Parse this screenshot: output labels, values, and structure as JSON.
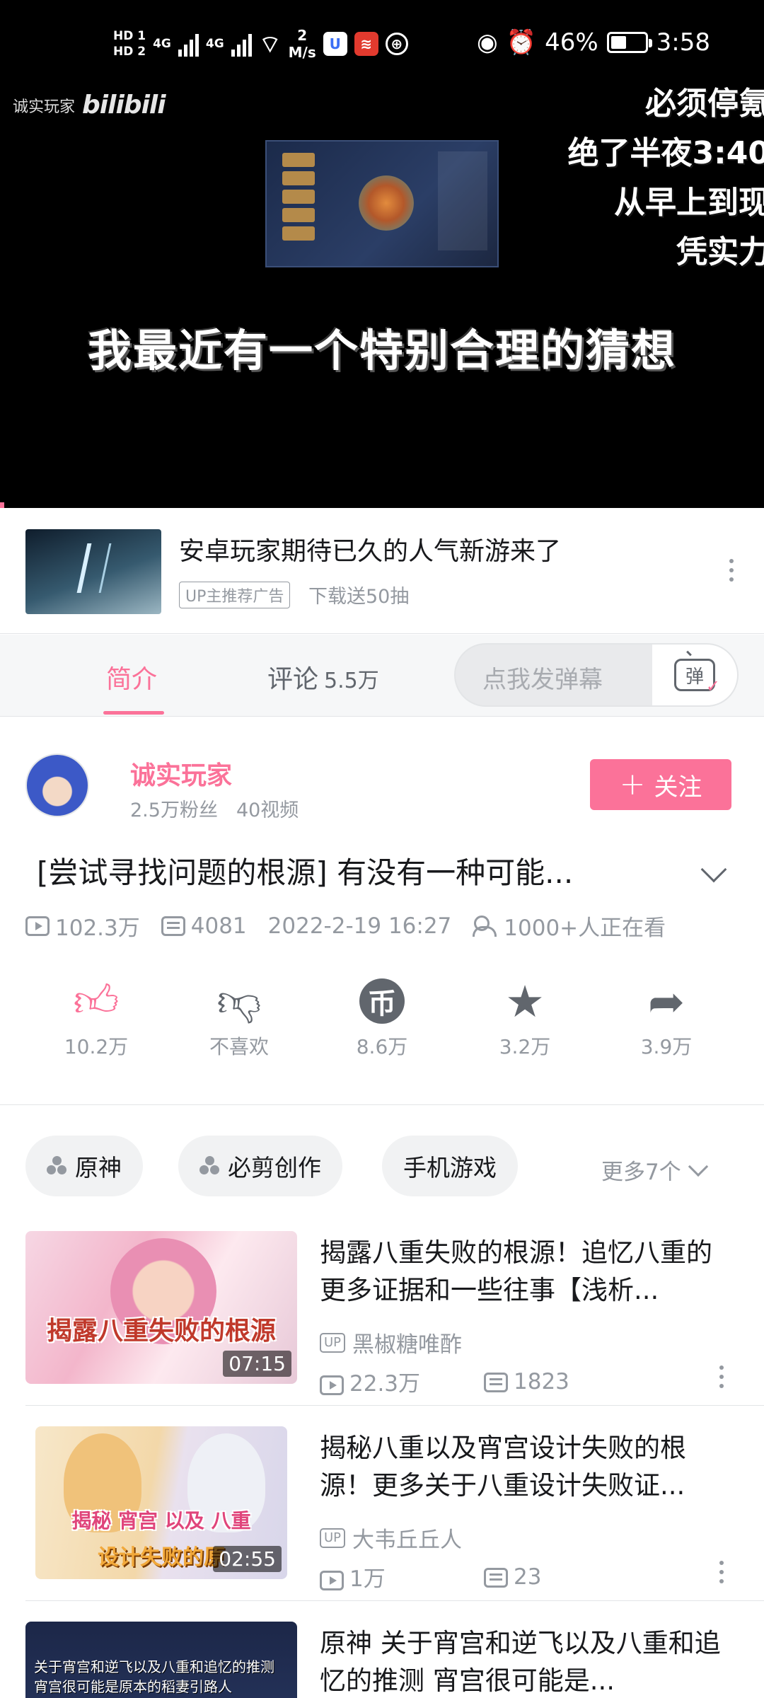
{
  "status_bar": {
    "hd1": "HD 1",
    "hd2": "HD 2",
    "net1": "4G",
    "net2": "4G",
    "speed_value": "2",
    "speed_unit": "M/s",
    "battery": "46%",
    "battery_level": 0.46,
    "time": "3:58"
  },
  "player": {
    "watermark_name": "诚实玩家",
    "watermark_logo": "bilibili",
    "overlay_lines": [
      "必须停氪",
      "绝了半夜3:40",
      "从早上到现",
      "凭实力"
    ],
    "subtitle": "我最近有一个特别合理的猜想"
  },
  "ad": {
    "title": "安卓玩家期待已久的人气新游来了",
    "tag": "UP主推荐广告",
    "subtitle": "下载送50抽"
  },
  "tabs": {
    "intro": "简介",
    "comments": "评论",
    "comments_count": "5.5万",
    "danmaku_placeholder": "点我发弹幕",
    "danmaku_icon_char": "弹"
  },
  "uploader": {
    "name": "诚实玩家",
    "fans": "2.5万粉丝",
    "videos": "40视频",
    "follow_label": "关注"
  },
  "video": {
    "title": "[尝试寻找问题的根源] 有没有一种可能...",
    "views": "102.3万",
    "danmaku_count": "4081",
    "date": "2022-2-19 16:27",
    "watching": "1000+人正在看"
  },
  "actions": {
    "like": "10.2万",
    "dislike": "不喜欢",
    "coin": "8.6万",
    "favorite": "3.2万",
    "share": "3.9万"
  },
  "tags": {
    "items": [
      "原神",
      "必剪创作",
      "手机游戏"
    ],
    "more": "更多7个"
  },
  "related": [
    {
      "title": "揭露八重失败的根源！追忆八重的更多证据和一些往事【浅析...",
      "uploader": "黑椒糖唯酢",
      "views": "22.3万",
      "danmaku": "1823",
      "duration": "07:15",
      "thumb_text": "揭露八重失败的根源"
    },
    {
      "title": "揭秘八重以及宵宫设计失败的根源！更多关于八重设计失败证...",
      "uploader": "大韦丘丘人",
      "views": "1万",
      "danmaku": "23",
      "duration": "02:55",
      "thumb_text_top": "揭秘 宵宫 以及 八重",
      "thumb_text_bottom": "设计失败的原"
    },
    {
      "title": "原神 关于宵宫和逆飞以及八重和追忆的推测 宵宫很可能是...",
      "thumb_text": "关于宵宫和逆飞以及八重和追忆的推测 宵宫很可能是原本的稻妻引路人"
    }
  ],
  "up_badge": "UP"
}
